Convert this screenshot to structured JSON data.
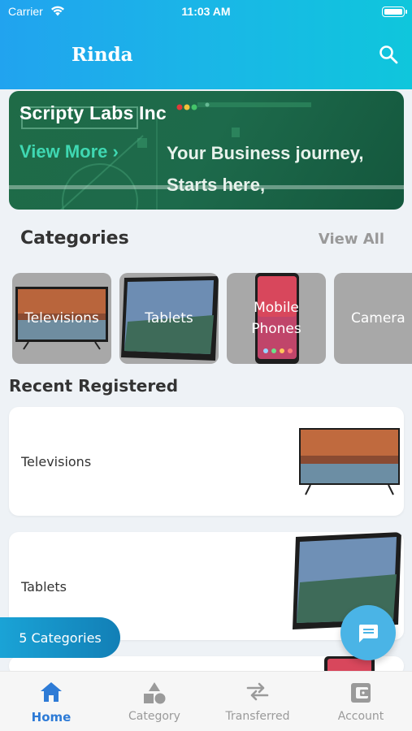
{
  "status_bar": {
    "carrier": "Carrier",
    "time": "11:03 AM"
  },
  "header": {
    "title": "Rinda",
    "search_icon": "search-icon"
  },
  "banner": {
    "title": "Scripty Labs Inc",
    "cta": "View More",
    "tagline_line1": "Your Business journey,",
    "tagline_line2": "Starts here,"
  },
  "categories": {
    "title": "Categories",
    "view_all": "View All",
    "items": [
      {
        "label": "Televisions"
      },
      {
        "label": "Tablets"
      },
      {
        "label": "Mobile Phones"
      },
      {
        "label": "Camera"
      }
    ]
  },
  "recent": {
    "title": "Recent Registered",
    "items": [
      {
        "label": "Televisions"
      },
      {
        "label": "Tablets"
      },
      {
        "label": ""
      }
    ]
  },
  "floating": {
    "categories_pill": "5 Categories",
    "chat_icon": "chat-icon"
  },
  "bottom_nav": {
    "items": [
      {
        "label": "Home",
        "icon": "home-icon",
        "active": true
      },
      {
        "label": "Category",
        "icon": "category-icon",
        "active": false
      },
      {
        "label": "Transferred",
        "icon": "transfer-icon",
        "active": false
      },
      {
        "label": "Account",
        "icon": "wallet-icon",
        "active": false
      }
    ]
  },
  "colors": {
    "accent": "#2e7bd6",
    "header_start": "#21a3ef",
    "header_end": "#0fc6dc",
    "banner": "#1f6b47"
  }
}
